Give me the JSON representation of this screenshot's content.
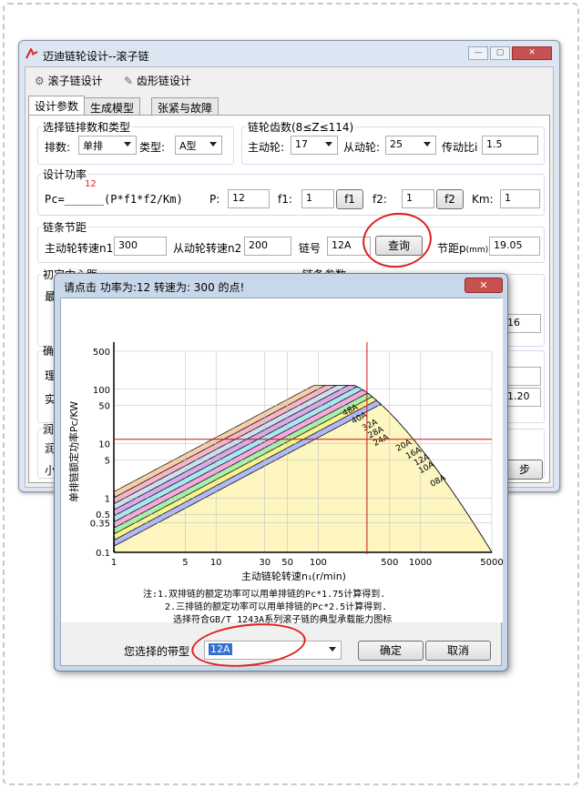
{
  "main_window": {
    "title": "迈迪链轮设计--滚子链",
    "toolbar": {
      "roller": "滚子链设计",
      "tooth": "齿形链设计"
    },
    "tabs": [
      "设计参数",
      "生成模型",
      "张紧与故障"
    ],
    "chain_type": {
      "title": "选择链排数和类型",
      "rows_label": "排数:",
      "rows_value": "单排",
      "type_label": "类型:",
      "type_value": "A型"
    },
    "teeth": {
      "title": "链轮齿数(8≤Z≤114)",
      "driver_label": "主动轮:",
      "driver_value": "17",
      "driven_label": "从动轮:",
      "driven_value": "25",
      "ratio_label": "传动比i",
      "ratio_value": "1.5"
    },
    "power": {
      "title": "设计功率",
      "superscript": "12",
      "formula": "Pc=______(P*f1*f2/Km)",
      "p_label": "P:",
      "p_value": "12",
      "f1_label": "f1:",
      "f1_value": "1",
      "f1_button": "f1",
      "f2_label": "f2:",
      "f2_value": "1",
      "f2_button": "f2",
      "km_label": "Km:",
      "km_value": "1"
    },
    "pitch": {
      "title": "链条节距",
      "n1_label": "主动轮转速n1",
      "n1_value": "300",
      "n2_label": "从动轮转速n2",
      "n2_value": "200",
      "chain_no_label": "链号",
      "chain_no_value": "12A",
      "query_button": "查询",
      "pitch_label": "节距p",
      "pitch_unit": "(mm)",
      "pitch_value": "19.05"
    },
    "center": {
      "title": "初定中心距",
      "partial_label": "最",
      "right_title": "链条参数",
      "partial_value": "16"
    },
    "hidden_labels": [
      "确",
      "理",
      "实",
      "润",
      "润",
      "小"
    ],
    "partial_values": [
      "1.20"
    ],
    "partial_button": "步"
  },
  "dialog": {
    "title": "请点击 功率为:12 转速为: 300 的点!",
    "close": "✕",
    "select_label": "您选择的带型",
    "select_value": "12A",
    "ok_button": "确定",
    "cancel_button": "取消",
    "notes": [
      "注:1.双排链的额定功率可以用单排链的Pc*1.75计算得到.",
      "2.三排链的额定功率可以用单排链的Pc*2.5计算得到.",
      "选择符合GB/T 1243A系列滚子链的典型承载能力图标"
    ]
  },
  "chart_data": {
    "type": "area",
    "xlabel": "主动链轮转速n₁(r/min)",
    "ylabel": "单排链额定功率Pc/KW",
    "x_scale": "log",
    "y_scale": "log",
    "xlim": [
      1,
      5000
    ],
    "ylim": [
      0.1,
      500
    ],
    "x_ticks": [
      1,
      5,
      10,
      30,
      50,
      100,
      500,
      1000,
      5000
    ],
    "x_tick_labels": [
      "1",
      "5",
      "10",
      "30",
      "50",
      "100",
      "500",
      "1000",
      "5000"
    ],
    "y_ticks": [
      0.1,
      0.35,
      0.5,
      1,
      5,
      10,
      50,
      100,
      500
    ],
    "y_tick_labels": [
      "0.1",
      "0.35",
      "0.5",
      "1",
      "5",
      "10",
      "50",
      "100",
      "500"
    ],
    "series": [
      {
        "name": "48A",
        "color": "#f6cfa8"
      },
      {
        "name": "40A",
        "color": "#f8b4c8"
      },
      {
        "name": "32A",
        "color": "#cde0f0"
      },
      {
        "name": "28A",
        "color": "#d8a8e8"
      },
      {
        "name": "24A",
        "color": "#a8e8f0"
      },
      {
        "name": "20A",
        "color": "#f8a8e0"
      },
      {
        "name": "16A",
        "color": "#a8f0a8"
      },
      {
        "name": "12A",
        "color": "#f8f48c"
      },
      {
        "name": "10A",
        "color": "#b0b8f8"
      },
      {
        "name": "08A",
        "color": "#fdf6c0"
      }
    ],
    "crosshair": {
      "x": 300,
      "y": 12
    }
  }
}
